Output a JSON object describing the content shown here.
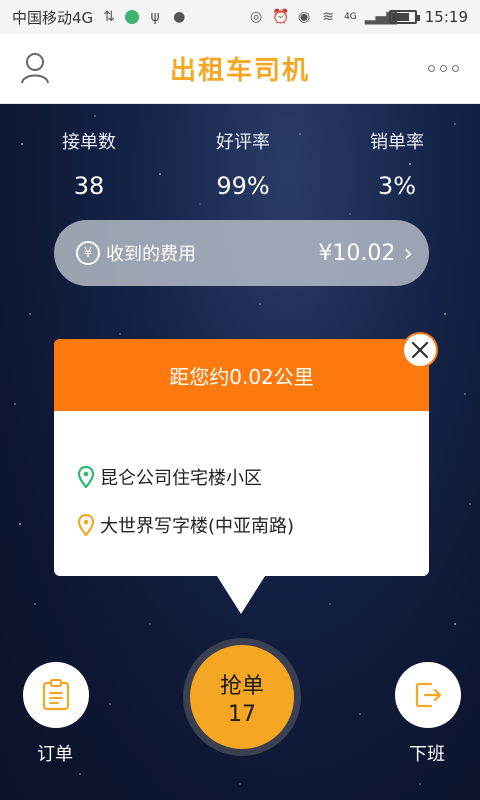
{
  "status_bar": {
    "carrier": "中国移动4G",
    "time": "15:19",
    "signal_badge": "4G"
  },
  "header": {
    "title": "出租车司机"
  },
  "stats": [
    {
      "label": "接单数",
      "value": "38"
    },
    {
      "label": "好评率",
      "value": "99%"
    },
    {
      "label": "销单率",
      "value": "3%"
    }
  ],
  "fee": {
    "icon": "¥",
    "label": "收到的费用",
    "amount": "¥10.02",
    "chevron": "›"
  },
  "order_card": {
    "distance_text": "距您约0.02公里",
    "pickup": "昆仑公司住宅楼小区",
    "dropoff": "大世界写字楼(中亚南路)",
    "colors": {
      "header": "#ff7a0e",
      "pickup_pin": "#2eb872",
      "dropoff_pin": "#f5a623"
    }
  },
  "actions": {
    "orders_label": "订单",
    "grab_label": "抢单",
    "grab_count": "17",
    "offwork_label": "下班"
  },
  "colors": {
    "accent": "#f5a623",
    "orange": "#ff7a0e",
    "background": "#0e1733"
  }
}
